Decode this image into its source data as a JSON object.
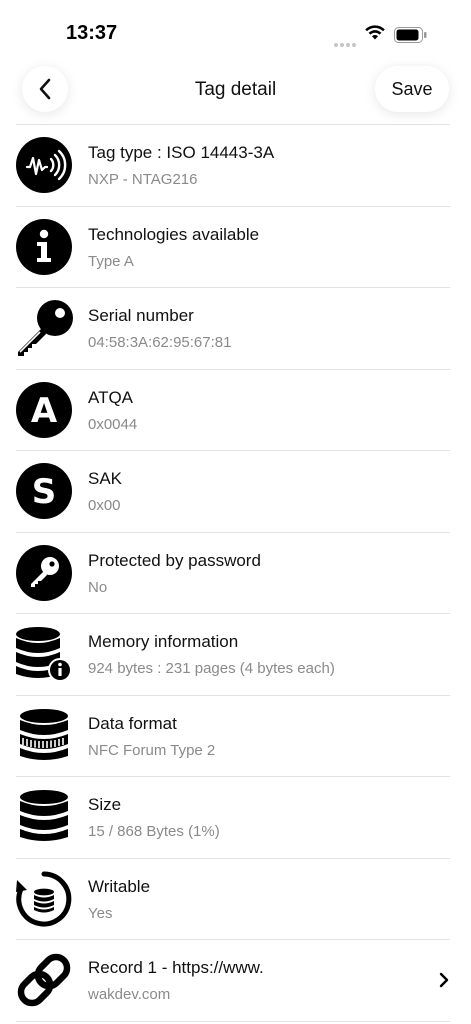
{
  "status_bar": {
    "time": "13:37"
  },
  "nav": {
    "title": "Tag detail",
    "save_label": "Save"
  },
  "rows": [
    {
      "title": "Tag type : ISO 14443-3A",
      "subtitle": "NXP - NTAG216",
      "icon": "nfc-wave-icon"
    },
    {
      "title": "Technologies available",
      "subtitle": "Type A",
      "icon": "info-icon"
    },
    {
      "title": "Serial number",
      "subtitle": "04:58:3A:62:95:67:81",
      "icon": "key-icon"
    },
    {
      "title": "ATQA",
      "subtitle": "0x0044",
      "icon": "letter-a-icon"
    },
    {
      "title": "SAK",
      "subtitle": "0x00",
      "icon": "letter-s-icon"
    },
    {
      "title": "Protected by password",
      "subtitle": "No",
      "icon": "key-circle-icon"
    },
    {
      "title": "Memory information",
      "subtitle": "924 bytes : 231 pages (4 bytes each)",
      "icon": "database-info-icon"
    },
    {
      "title": "Data format",
      "subtitle": "NFC Forum Type 2",
      "icon": "database-format-icon"
    },
    {
      "title": "Size",
      "subtitle": "15 / 868 Bytes (1%)",
      "icon": "database-icon"
    },
    {
      "title": "Writable",
      "subtitle": "Yes",
      "icon": "database-refresh-icon"
    },
    {
      "title": "Record 1 - https://www.",
      "subtitle": "wakdev.com",
      "icon": "link-icon"
    }
  ]
}
